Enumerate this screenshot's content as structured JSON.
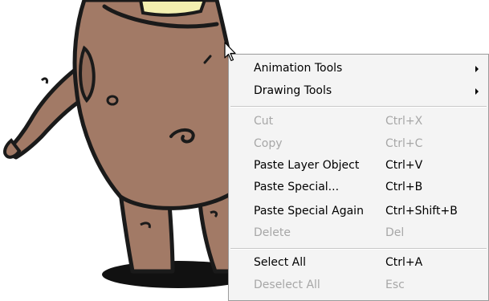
{
  "context_menu": {
    "items": [
      {
        "label": "Animation Tools",
        "shortcut": "",
        "submenu": true,
        "enabled": true
      },
      {
        "label": "Drawing Tools",
        "shortcut": "",
        "submenu": true,
        "enabled": true
      },
      {
        "label": "Cut",
        "shortcut": "Ctrl+X",
        "submenu": false,
        "enabled": false
      },
      {
        "label": "Copy",
        "shortcut": "Ctrl+C",
        "submenu": false,
        "enabled": false
      },
      {
        "label": "Paste Layer Object",
        "shortcut": "Ctrl+V",
        "submenu": false,
        "enabled": true
      },
      {
        "label": "Paste Special...",
        "shortcut": "Ctrl+B",
        "submenu": false,
        "enabled": true
      },
      {
        "label": "Paste Special Again",
        "shortcut": "Ctrl+Shift+B",
        "submenu": false,
        "enabled": true
      },
      {
        "label": "Delete",
        "shortcut": "Del",
        "submenu": false,
        "enabled": false
      },
      {
        "label": "Select All",
        "shortcut": "Ctrl+A",
        "submenu": false,
        "enabled": true
      },
      {
        "label": "Deselect All",
        "shortcut": "Esc",
        "submenu": false,
        "enabled": false
      }
    ]
  },
  "colors": {
    "character_fill": "#a27a66",
    "outline": "#1a1a1a",
    "menu_bg": "#f4f4f4",
    "disabled_text": "#a7a7a7",
    "eye_yellow": "#f4f0b0"
  }
}
